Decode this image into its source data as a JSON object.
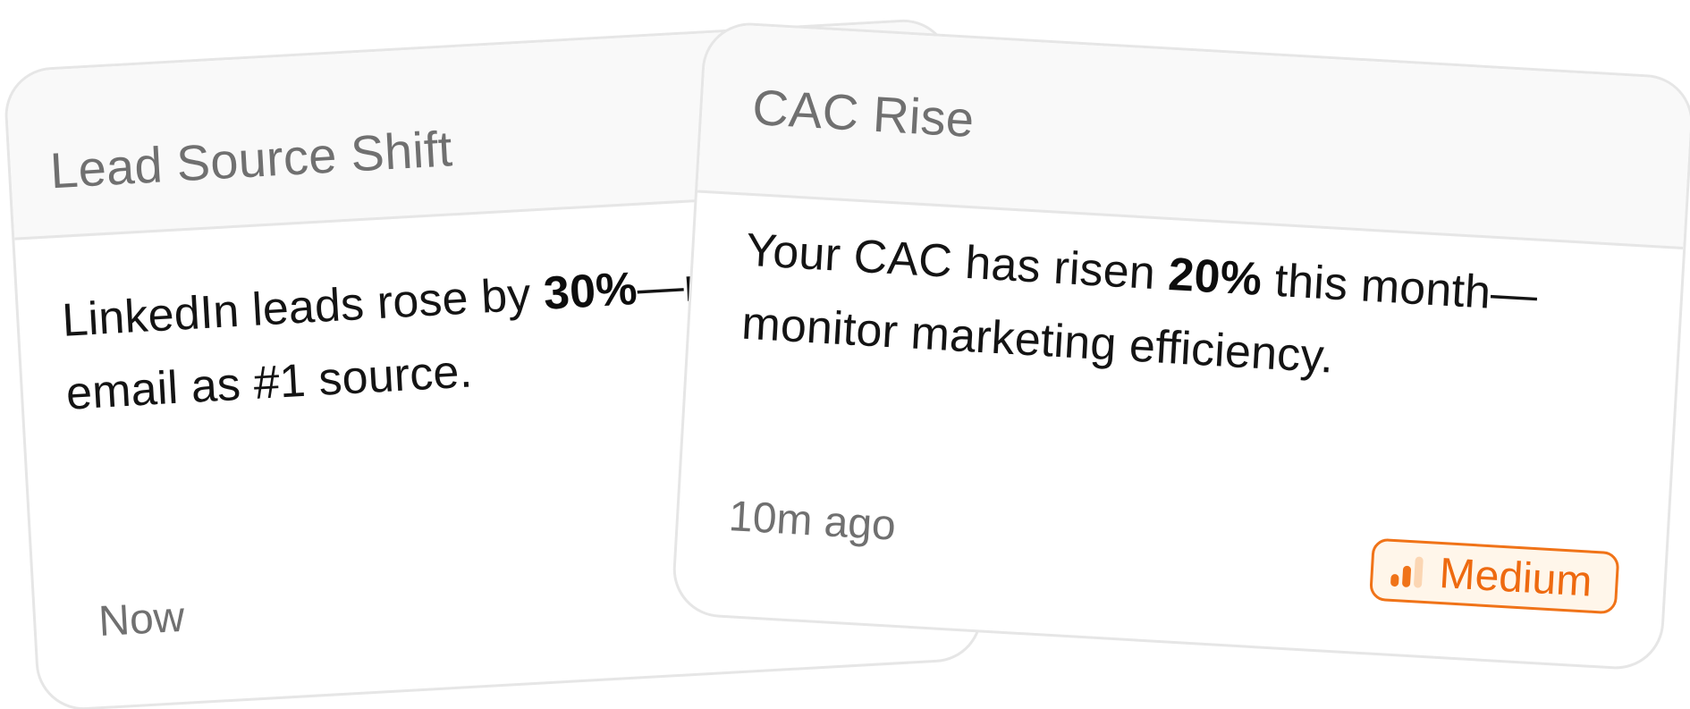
{
  "cards": [
    {
      "title": "Lead Source Shift",
      "message": {
        "before": "LinkedIn leads rose by ",
        "highlight": "30%",
        "after": "—replacing email as #1 source."
      },
      "timestamp": "Now"
    },
    {
      "title": "CAC Rise",
      "message": {
        "before": "Your CAC has risen ",
        "highlight": "20%",
        "after": " this month—monitor marketing efficiency."
      },
      "timestamp": "10m ago",
      "priority": {
        "label": "Medium",
        "icon": "signal-bars-icon",
        "level": 2,
        "max_level": 3,
        "color": "#f07318",
        "background": "#fff6ea"
      }
    }
  ],
  "colors": {
    "card_border": "#e6e6e6",
    "header_bg": "#f9f9f9",
    "title_text": "#707070",
    "body_text": "#141414"
  }
}
